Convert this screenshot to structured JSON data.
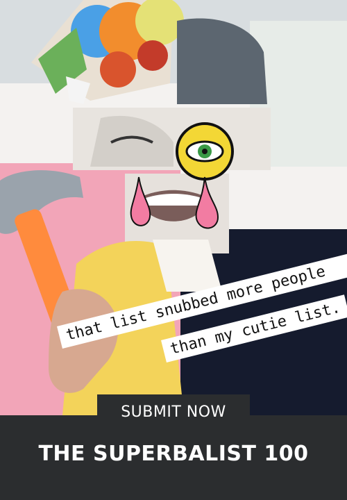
{
  "caption": {
    "line1": "that list snubbed more people",
    "line2": "than my cutie list."
  },
  "cta": {
    "label": "SUBMIT NOW"
  },
  "footer": {
    "title": "THE SUPERBALIST 100"
  },
  "colors": {
    "pink": "#f2a5b8",
    "navy": "#151b2e",
    "yellow": "#f3d35a",
    "hammer_orange": "#ff8b3d",
    "footer_bg": "#2b2d2f"
  }
}
